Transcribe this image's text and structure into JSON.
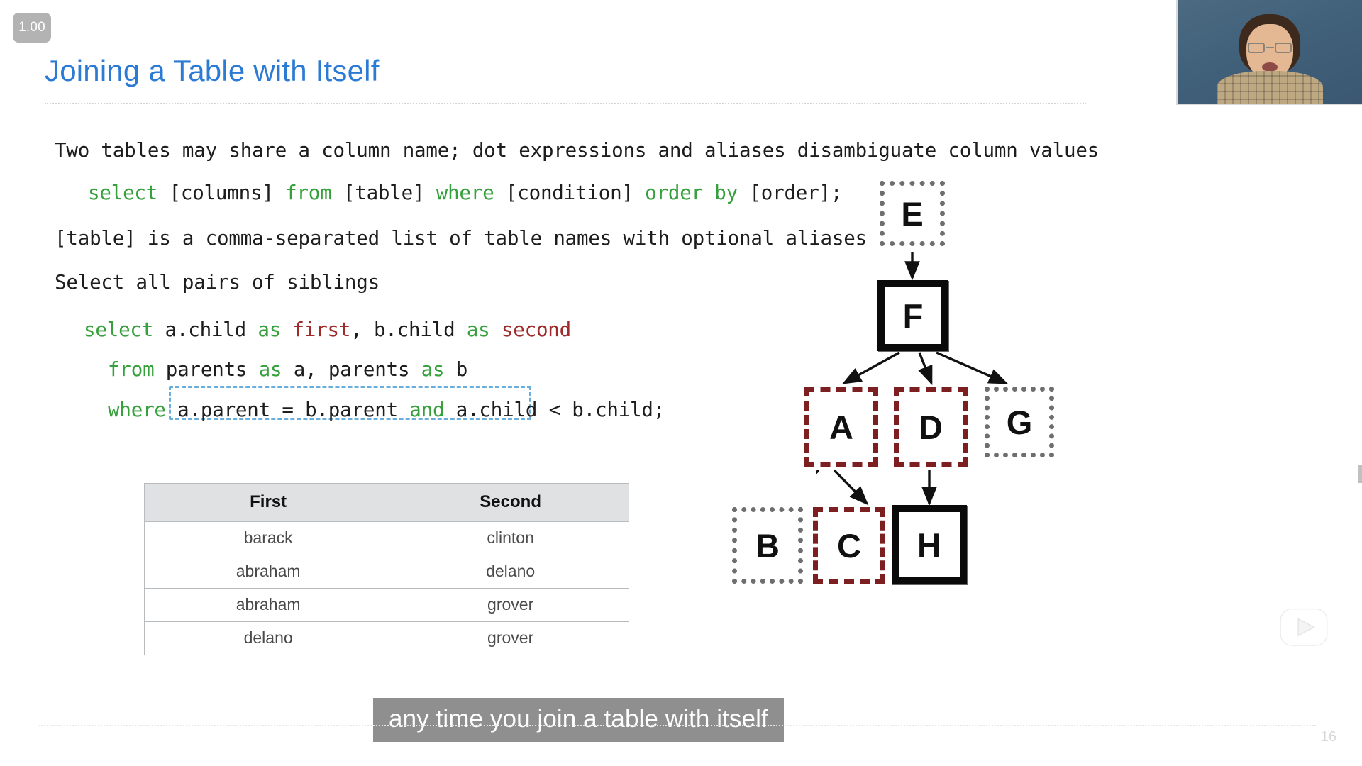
{
  "player": {
    "speed_badge": "1.00",
    "page_number": "16",
    "play_watermark_icon": "tv-play-icon",
    "webcam_label": "instructor-webcam"
  },
  "slide": {
    "title": "Joining a Table with Itself",
    "title_color": "#2b7bd4",
    "body": {
      "intro": "Two tables may share a column name; dot expressions and aliases disambiguate column values",
      "syntax": {
        "kw_select": "select",
        "columns": " [columns] ",
        "kw_from": "from",
        "table": " [table] ",
        "kw_where": "where",
        "condition": " [condition] ",
        "kw_orderby": "order by",
        "order": " [order];"
      },
      "table_note": "[table] is a comma-separated list of table names with optional aliases",
      "prompt": "Select all pairs of siblings",
      "query": {
        "l1_kw_select": "select",
        "l1_col_a": " a.child ",
        "l1_kw_as1": "as",
        "l1_alias1": " first",
        "l1_sep": ", ",
        "l1_col_b": "b.child ",
        "l1_kw_as2": "as",
        "l1_alias2": " second",
        "l2_kw_from": "from",
        "l2_tables": " parents as a, parents as b",
        "l2_t1": "parents ",
        "l2_as1": "as",
        "l2_a1": " a, ",
        "l2_t2": "parents ",
        "l2_as2": "as",
        "l2_a2": " b",
        "l3_kw_where": "where",
        "l3_cond1": " a.parent = b.parent ",
        "l3_kw_and": "and",
        "l3_cond2": " a.child < b.child;"
      }
    },
    "result_table": {
      "headers": [
        "First",
        "Second"
      ],
      "rows": [
        [
          "barack",
          "clinton"
        ],
        [
          "abraham",
          "delano"
        ],
        [
          "abraham",
          "grover"
        ],
        [
          "delano",
          "grover"
        ]
      ]
    },
    "diagram": {
      "name": "family-tree-diagram",
      "nodes": [
        {
          "label": "E",
          "style": "dotted"
        },
        {
          "label": "F",
          "style": "solid"
        },
        {
          "label": "A",
          "style": "dashed"
        },
        {
          "label": "D",
          "style": "dashed"
        },
        {
          "label": "G",
          "style": "dotted"
        },
        {
          "label": "B",
          "style": "dotted"
        },
        {
          "label": "C",
          "style": "dashed"
        },
        {
          "label": "H",
          "style": "solid"
        }
      ],
      "edges": [
        [
          "E",
          "F"
        ],
        [
          "F",
          "A"
        ],
        [
          "F",
          "D"
        ],
        [
          "F",
          "G"
        ],
        [
          "A",
          "B"
        ],
        [
          "A",
          "C"
        ],
        [
          "D",
          "H"
        ]
      ]
    },
    "colors": {
      "keyword_green": "#36a13c",
      "alias_red": "#9e2a2a",
      "annotation_blue": "#6aaede",
      "node_dashed_red": "#7d1f20",
      "node_dotted_gray": "#6e6e6e"
    }
  },
  "caption": {
    "text": "any time you join a table with itself"
  }
}
